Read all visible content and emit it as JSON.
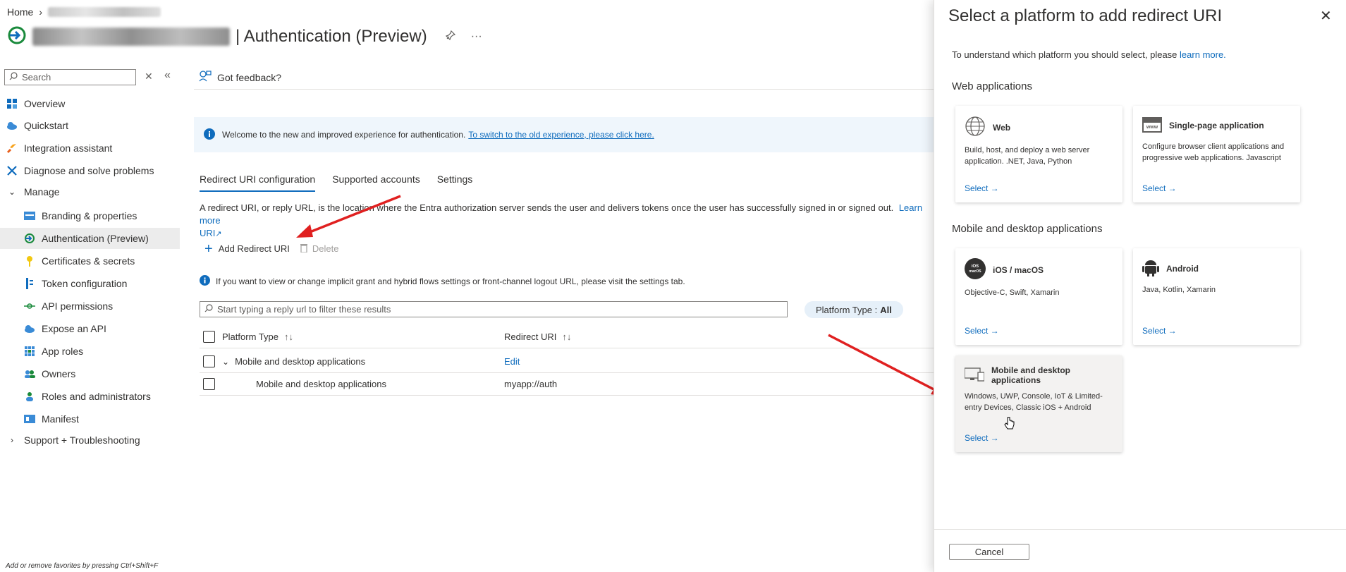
{
  "breadcrumb": {
    "home": "Home",
    "separator": "›"
  },
  "header": {
    "title": "| Authentication (Preview)",
    "pin_icon": "pin-icon",
    "more_icon": "ellipsis-icon"
  },
  "sidebar": {
    "search_placeholder": "Search",
    "items": [
      {
        "label": "Overview",
        "icon": "overview-icon",
        "level": "top"
      },
      {
        "label": "Quickstart",
        "icon": "cloud-icon",
        "level": "top"
      },
      {
        "label": "Integration assistant",
        "icon": "rocket-icon",
        "level": "top"
      },
      {
        "label": "Diagnose and solve problems",
        "icon": "wrench-icon",
        "level": "top"
      },
      {
        "label": "Manage",
        "icon": "chevron-down-icon",
        "level": "group"
      },
      {
        "label": "Branding & properties",
        "icon": "branding-icon",
        "level": "sub"
      },
      {
        "label": "Authentication (Preview)",
        "icon": "authentication-icon",
        "level": "sub",
        "active": true
      },
      {
        "label": "Certificates & secrets",
        "icon": "key-icon",
        "level": "sub"
      },
      {
        "label": "Token configuration",
        "icon": "token-icon",
        "level": "sub"
      },
      {
        "label": "API permissions",
        "icon": "api-icon",
        "level": "sub"
      },
      {
        "label": "Expose an API",
        "icon": "cloud-api-icon",
        "level": "sub"
      },
      {
        "label": "App roles",
        "icon": "grid-icon",
        "level": "sub"
      },
      {
        "label": "Owners",
        "icon": "people-icon",
        "level": "sub"
      },
      {
        "label": "Roles and administrators",
        "icon": "person-icon",
        "level": "sub"
      },
      {
        "label": "Manifest",
        "icon": "manifest-icon",
        "level": "sub"
      },
      {
        "label": "Support + Troubleshooting",
        "icon": "chevron-right-icon",
        "level": "group"
      }
    ],
    "fav_hint": "Add or remove favorites by pressing Ctrl+Shift+F"
  },
  "content": {
    "feedback": "Got feedback?",
    "banner_text": "Welcome to the new and improved experience for authentication.",
    "banner_link": "To switch to the old experience, please click here.",
    "tabs": [
      "Redirect URI configuration",
      "Supported accounts",
      "Settings"
    ],
    "description": "A redirect URI, or reply URL, is the location where the Entra authorization server sends the user and delivers tokens once the user has successfully signed in or signed out.",
    "learn_more": "Learn more",
    "learn_more_cont": "URI",
    "add_redirect": "Add Redirect URI",
    "delete": "Delete",
    "info_text": "If you want to view or change implicit grant and hybrid flows settings or front-channel logout URL, please visit the settings tab.",
    "filter_placeholder": "Start typing a reply url to filter these results",
    "platform_filter_label": "Platform Type :",
    "platform_filter_value": "All",
    "table": {
      "headers": [
        "Platform Type",
        "Redirect URI"
      ],
      "sort_glyph": "↑↓",
      "rows": [
        {
          "platform": "Mobile and desktop applications",
          "uri": "Edit",
          "group": true
        },
        {
          "platform": "Mobile and desktop applications",
          "uri": "myapp://auth",
          "group": false
        }
      ]
    }
  },
  "panel": {
    "title": "Select a platform to add redirect URI",
    "intro": "To understand which platform you should select, please",
    "intro_link": "learn more.",
    "section_web": "Web applications",
    "section_mobile": "Mobile and desktop applications",
    "select_label": "Select →",
    "cards": [
      {
        "title": "Web",
        "desc": "Build, host, and deploy a web server application. .NET, Java, Python",
        "icon": "globe-icon"
      },
      {
        "title": "Single-page application",
        "desc": "Configure browser client applications and progressive web applications. Javascript",
        "icon": "www-icon"
      },
      {
        "title": "iOS / macOS",
        "desc": "Objective-C, Swift, Xamarin",
        "icon": "apple-icon"
      },
      {
        "title": "Android",
        "desc": "Java, Kotlin, Xamarin",
        "icon": "android-icon"
      },
      {
        "title": "Mobile and desktop applications",
        "desc": "Windows, UWP, Console, IoT & Limited-entry Devices, Classic iOS + Android",
        "icon": "desktop-icon"
      }
    ],
    "cancel": "Cancel"
  },
  "colors": {
    "accent": "#0f6cbd",
    "arrow": "#e02020",
    "active_nav": "#ececec"
  }
}
